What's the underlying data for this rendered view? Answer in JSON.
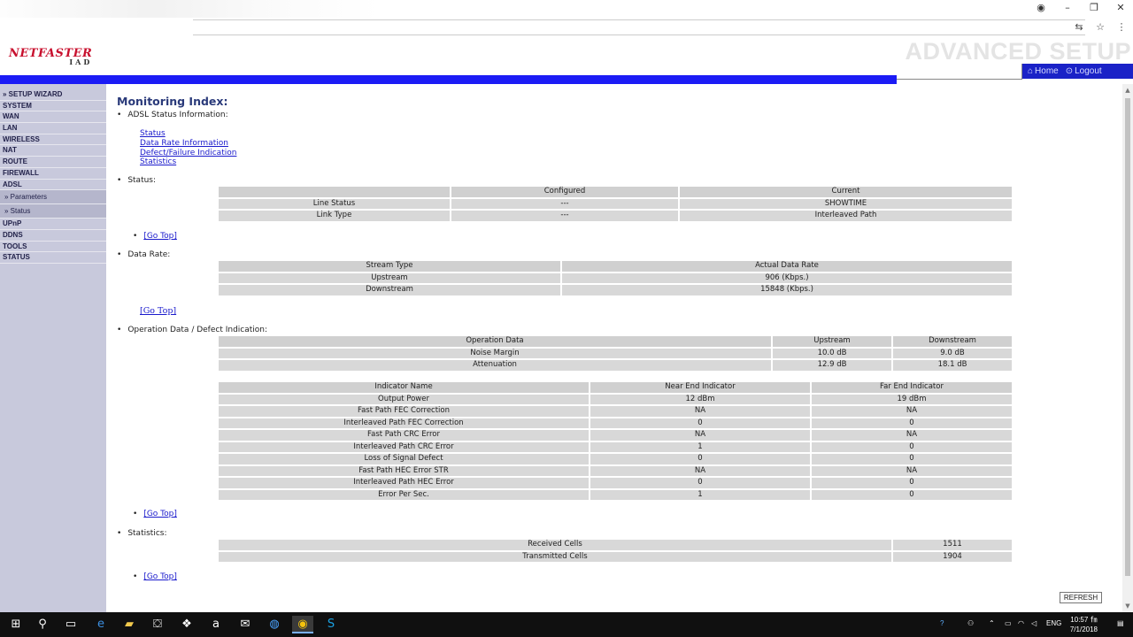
{
  "header": {
    "logo": "NETFASTER",
    "logo_sub": "IAD",
    "advanced": "ADVANCED SETUP",
    "nav_home": "Home",
    "nav_logout": "Logout"
  },
  "sidebar": {
    "items": [
      "» SETUP WIZARD",
      "SYSTEM",
      "WAN",
      "LAN",
      "WIRELESS",
      "NAT",
      "ROUTE",
      "FIREWALL",
      "ADSL"
    ],
    "sub_items": [
      "» Parameters",
      "» Status"
    ],
    "items2": [
      "UPnP",
      "DDNS",
      "TOOLS",
      "STATUS"
    ]
  },
  "main": {
    "title": "Monitoring Index:",
    "adsl_info": "ADSL Status Information:",
    "links": [
      "Status",
      "Data Rate Information",
      "Defect/Failure Indication",
      "Statistics"
    ],
    "status_label": "Status:",
    "go_top": "[Go Top]",
    "status_table": {
      "headers": [
        "",
        "Configured",
        "Current"
      ],
      "rows": [
        [
          "Line Status",
          "---",
          "SHOWTIME"
        ],
        [
          "Link Type",
          "---",
          "Interleaved Path"
        ]
      ]
    },
    "data_rate_label": "Data Rate:",
    "data_rate_table": {
      "headers": [
        "Stream Type",
        "Actual Data Rate"
      ],
      "rows": [
        [
          "Upstream",
          "906 (Kbps.)"
        ],
        [
          "Downstream",
          "15848 (Kbps.)"
        ]
      ]
    },
    "operation_label": "Operation Data / Defect Indication:",
    "operation_table": {
      "headers": [
        "Operation Data",
        "Upstream",
        "Downstream"
      ],
      "rows": [
        [
          "Noise Margin",
          "10.0 dB",
          "9.0 dB"
        ],
        [
          "Attenuation",
          "12.9 dB",
          "18.1 dB"
        ]
      ]
    },
    "indicator_table": {
      "headers": [
        "Indicator Name",
        "Near End Indicator",
        "Far End Indicator"
      ],
      "rows": [
        [
          "Output Power",
          "12 dBm",
          "19 dBm"
        ],
        [
          "Fast Path FEC Correction",
          "NA",
          "NA"
        ],
        [
          "Interleaved Path FEC Correction",
          "0",
          "0"
        ],
        [
          "Fast Path CRC Error",
          "NA",
          "NA"
        ],
        [
          "Interleaved Path CRC Error",
          "1",
          "0"
        ],
        [
          "Loss of Signal Defect",
          "0",
          "0"
        ],
        [
          "Fast Path HEC Error STR",
          "NA",
          "NA"
        ],
        [
          "Interleaved Path HEC Error",
          "0",
          "0"
        ],
        [
          "Error Per Sec.",
          "1",
          "0"
        ]
      ]
    },
    "statistics_label": "Statistics:",
    "statistics_table": {
      "rows": [
        [
          "Received Cells",
          "1511"
        ],
        [
          "Transmitted Cells",
          "1904"
        ]
      ]
    },
    "refresh": "REFRESH"
  },
  "taskbar": {
    "lang": "ENG",
    "time": "10:57 ㎙",
    "date": "7/1/2018"
  },
  "colors": {
    "blue_bar": "#1b1bf5",
    "nav_box": "#1a22c7",
    "sidebar": "#c8c9dc",
    "title": "#2a3a7a",
    "link": "#1a1acc",
    "logo": "#c8102e"
  }
}
